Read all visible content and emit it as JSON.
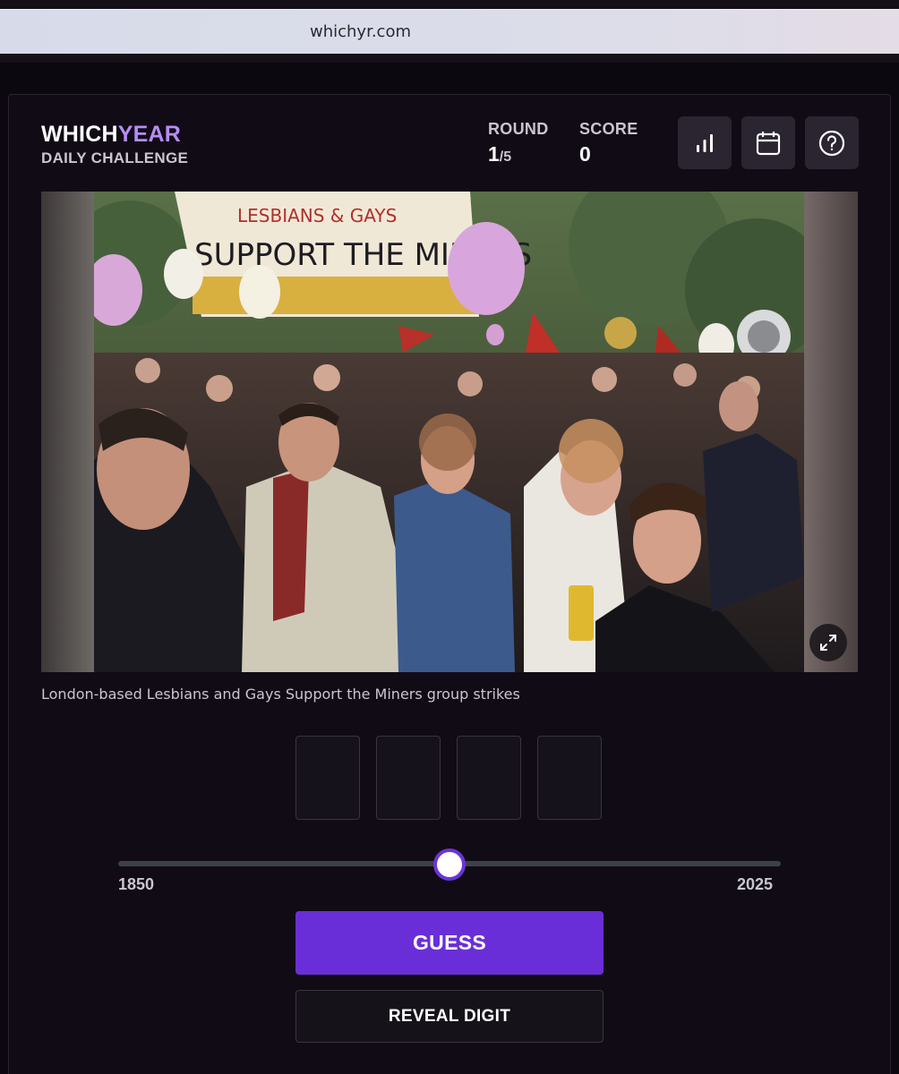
{
  "browser": {
    "url": "whichyr.com"
  },
  "brand": {
    "title_part1": "WHICH",
    "title_part2": "YEAR",
    "subtitle": "DAILY CHALLENGE"
  },
  "stats": {
    "round_label": "ROUND",
    "round_current": "1",
    "round_total": "/5",
    "score_label": "SCORE",
    "score_value": "0"
  },
  "toolbar": {
    "icons": [
      "bar-chart-icon",
      "calendar-icon",
      "help-icon"
    ]
  },
  "photo": {
    "banner_line1": "LESBIANS & GAYS",
    "banner_line2": "SUPPORT THE MINERS",
    "caption": "London-based Lesbians and Gays Support the Miners group strikes"
  },
  "guess": {
    "digits": [
      "",
      "",
      "",
      ""
    ]
  },
  "slider": {
    "min_label": "1850",
    "max_label": "2025",
    "min": 1850,
    "max": 2025,
    "position": 0.5
  },
  "actions": {
    "guess_label": "GUESS",
    "reveal_label": "REVEAL DIGIT"
  },
  "colors": {
    "accent": "#6a2ed8",
    "brand_highlight": "#b58cf5",
    "background": "#110b16"
  }
}
